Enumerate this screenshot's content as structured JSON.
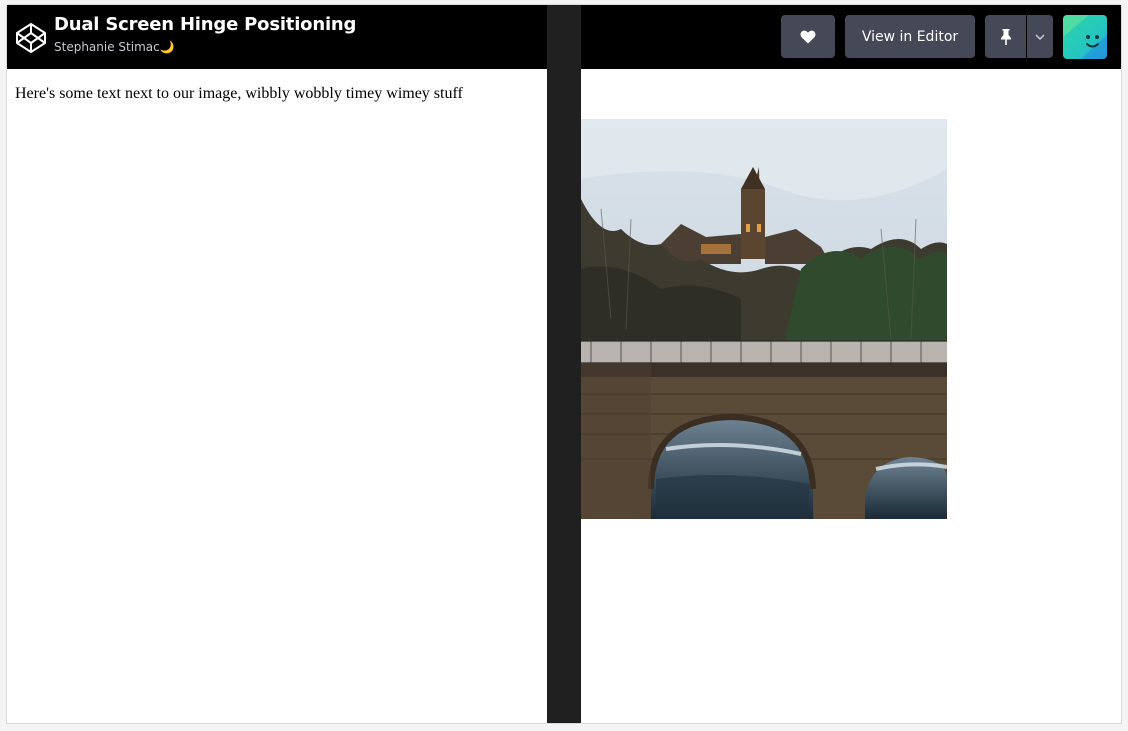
{
  "header": {
    "title": "Dual Screen Hinge Positioning",
    "author": "Stephanie Stimac",
    "author_emoji": "🌙",
    "buttons": {
      "heart_icon": "heart-icon",
      "editor_label": "View in Editor",
      "pin_icon": "pin-icon",
      "dropdown_icon": "chevron-down-icon"
    }
  },
  "content": {
    "left_text": "Here's some text next to our image, wibbly wobbly timey wimey stuff",
    "image_subject": "castle-bridge-photo"
  },
  "colors": {
    "header_bg": "#000000",
    "button_bg": "#444857",
    "hinge": "#202020",
    "page_bg": "#ffffff"
  }
}
